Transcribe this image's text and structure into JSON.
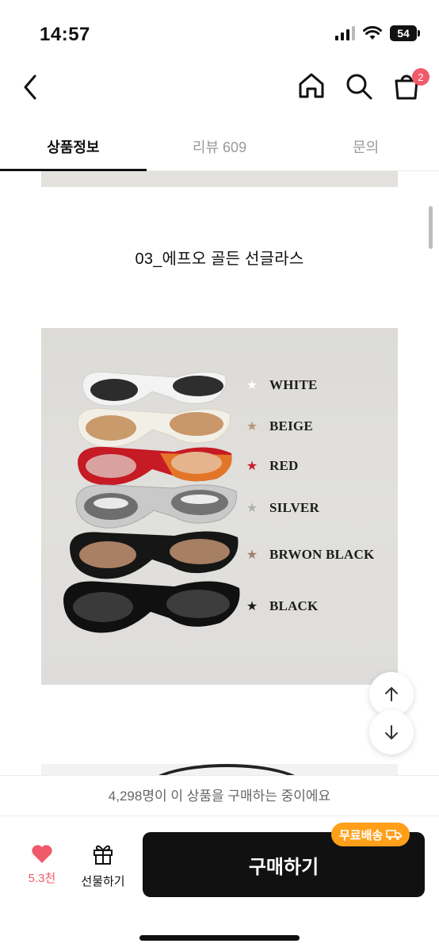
{
  "status_bar": {
    "time": "14:57",
    "battery": "54"
  },
  "nav": {
    "cart_count": "2"
  },
  "tabs": [
    {
      "label": "상품정보",
      "active": true
    },
    {
      "label": "리뷰 609",
      "active": false
    },
    {
      "label": "문의",
      "active": false
    }
  ],
  "product": {
    "title": "03_에프오 골든 선글라스",
    "colors": [
      {
        "label": "WHITE",
        "star_color": "#ffffff"
      },
      {
        "label": "BEIGE",
        "star_color": "#b8977a"
      },
      {
        "label": "RED",
        "star_color": "#c4202b"
      },
      {
        "label": "SILVER",
        "star_color": "#b0b0b0"
      },
      {
        "label": "BRWON BLACK",
        "star_color": "#9c8070"
      },
      {
        "label": "BLACK",
        "star_color": "#1a1a1a"
      }
    ]
  },
  "purchase_notice": "4,298명이 이 상품을 구매하는 중이에요",
  "bottom_bar": {
    "like_count": "5.3천",
    "gift_label": "선물하기",
    "buy_label": "구매하기",
    "free_shipping": "무료배송"
  },
  "colors": {
    "accent": "#f15a6b",
    "badge_orange": "#ff9f1a",
    "primary_dark": "#111111"
  },
  "icons": [
    "back-icon",
    "home-icon",
    "search-icon",
    "cart-icon",
    "arrow-up-icon",
    "arrow-down-icon",
    "heart-icon",
    "gift-icon",
    "truck-icon",
    "star-icon"
  ]
}
